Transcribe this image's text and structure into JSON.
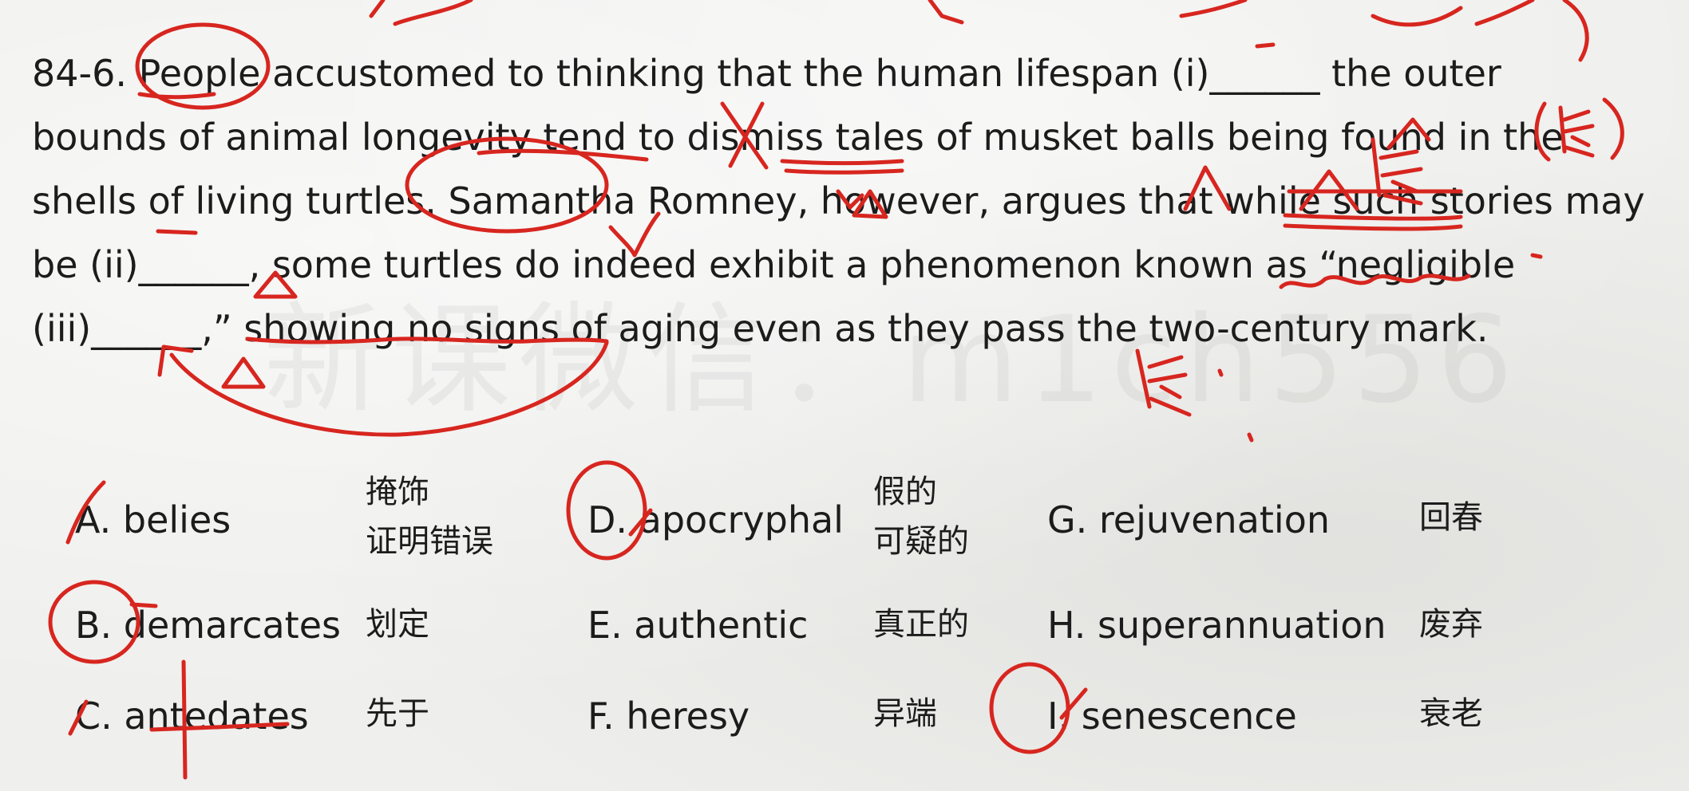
{
  "watermark": "新课微信：m1ch556",
  "question": {
    "lines": [
      "84-6. People accustomed to thinking that the human lifespan (i)______ the outer",
      "bounds of animal longevity tend to dismiss tales of musket balls being found in the",
      "shells of living turtles. Samantha Romney, however, argues that while such stories may",
      "be (ii)______, some turtles do indeed exhibit a phenomenon known as “negligible",
      "(iii)______,” showing no signs of aging even as they pass the two-century mark."
    ]
  },
  "options": [
    {
      "letter_label": "A. belies",
      "meaning_lines": [
        "掩饰",
        "证明错误"
      ]
    },
    {
      "letter_label": "B. demarcates",
      "meaning_lines": [
        "划定"
      ]
    },
    {
      "letter_label": "C. antedates",
      "meaning_lines": [
        "先于"
      ]
    },
    {
      "letter_label": "D. apocryphal",
      "meaning_lines": [
        "假的",
        "可疑的"
      ]
    },
    {
      "letter_label": "E. authentic",
      "meaning_lines": [
        "真正的"
      ]
    },
    {
      "letter_label": "F. heresy",
      "meaning_lines": [
        "异端"
      ]
    },
    {
      "letter_label": "G. rejuvenation",
      "meaning_lines": [
        "回春"
      ]
    },
    {
      "letter_label": "H. superannuation",
      "meaning_lines": [
        "废弃"
      ]
    },
    {
      "letter_label": "I. senescence",
      "meaning_lines": [
        "衰老"
      ]
    }
  ],
  "annotations": {
    "handwritten_right_margin": "(长)",
    "handwritten_below_text": "长",
    "handwritten_above_stories": "长",
    "ink_color": "#d7261f"
  }
}
